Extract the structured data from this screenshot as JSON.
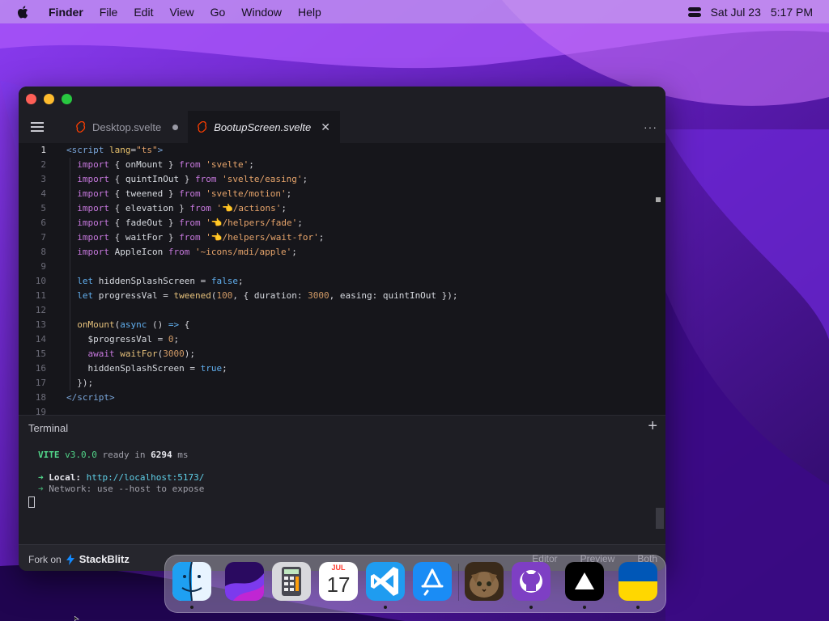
{
  "menubar": {
    "app_name": "Finder",
    "items": [
      "File",
      "Edit",
      "View",
      "Go",
      "Window",
      "Help"
    ],
    "date": "Sat Jul 23",
    "time": "5:17 PM"
  },
  "editor": {
    "tabs": [
      {
        "label": "Desktop.svelte",
        "active": false,
        "modified": true
      },
      {
        "label": "BootupScreen.svelte",
        "active": true,
        "close": "✕"
      }
    ],
    "more_menu": "···",
    "lines": [
      {
        "n": "1",
        "current": true
      },
      {
        "n": "2"
      },
      {
        "n": "3"
      },
      {
        "n": "4"
      },
      {
        "n": "5"
      },
      {
        "n": "6"
      },
      {
        "n": "7"
      },
      {
        "n": "8"
      },
      {
        "n": "9"
      },
      {
        "n": "10"
      },
      {
        "n": "11"
      },
      {
        "n": "12"
      },
      {
        "n": "13"
      },
      {
        "n": "14"
      },
      {
        "n": "15"
      },
      {
        "n": "16"
      },
      {
        "n": "17"
      },
      {
        "n": "18"
      },
      {
        "n": "19"
      }
    ],
    "code": {
      "l1": [
        "<",
        "script",
        " ",
        "lang",
        "=",
        "\"ts\"",
        ">"
      ],
      "l2": [
        "import",
        " { ",
        "onMount",
        " } ",
        "from",
        " ",
        "'svelte'",
        ";"
      ],
      "l3": [
        "import",
        " { ",
        "quintInOut",
        " } ",
        "from",
        " ",
        "'svelte/easing'",
        ";"
      ],
      "l4": [
        "import",
        " { ",
        "tweened",
        " } ",
        "from",
        " ",
        "'svelte/motion'",
        ";"
      ],
      "l5": [
        "import",
        " { ",
        "elevation",
        " } ",
        "from",
        " ",
        "'",
        "👈",
        "/actions'",
        ";"
      ],
      "l6": [
        "import",
        " { ",
        "fadeOut",
        " } ",
        "from",
        " ",
        "'",
        "👈",
        "/helpers/fade'",
        ";"
      ],
      "l7": [
        "import",
        " { ",
        "waitFor",
        " } ",
        "from",
        " ",
        "'",
        "👈",
        "/helpers/wait-for'",
        ";"
      ],
      "l8": [
        "import",
        " ",
        "AppleIcon",
        " ",
        "from",
        " ",
        "'~icons/mdi/apple'",
        ";"
      ],
      "l10": [
        "let",
        " ",
        "hiddenSplashScreen",
        " = ",
        "false",
        ";"
      ],
      "l11": [
        "let",
        " ",
        "progressVal",
        " = ",
        "tweened",
        "(",
        "100",
        ", { ",
        "duration",
        ": ",
        "3000",
        ", ",
        "easing",
        ": ",
        "quintInOut",
        " });"
      ],
      "l13": [
        "onMount",
        "(",
        "async",
        " () ",
        "=>",
        " {"
      ],
      "l14": [
        "$progressVal",
        " = ",
        "0",
        ";"
      ],
      "l15": [
        "await",
        " ",
        "waitFor",
        "(",
        "3000",
        ");"
      ],
      "l16": [
        "hiddenSplashScreen",
        " = ",
        "true",
        ";"
      ],
      "l17": [
        "});"
      ],
      "l18": [
        "</",
        "script",
        ">"
      ]
    }
  },
  "terminal": {
    "title": "Terminal",
    "add": "+",
    "vite": "VITE",
    "vite_version": "v3.0.0",
    "ready_text": "ready in",
    "ready_ms": "6294",
    "ms": "ms",
    "arrow": "➜",
    "local_label": "Local:",
    "local_url": "http://localhost:5173/",
    "network_label": "Network:",
    "network_hint": "use --host to expose"
  },
  "footer": {
    "fork_on": "Fork on",
    "brand": "StackBlitz",
    "modes": [
      "Editor",
      "Preview",
      "Both"
    ]
  },
  "dock": {
    "apps": [
      {
        "name": "Finder",
        "icon": "finder-icon",
        "running": true
      },
      {
        "name": "Wallpapers",
        "icon": "wallpaper-icon",
        "running": false
      },
      {
        "name": "Calculator",
        "icon": "calculator-icon",
        "running": false
      },
      {
        "name": "Calendar",
        "icon": "calendar-icon",
        "running": false,
        "month": "JUL",
        "day": "17"
      },
      {
        "name": "VS Code",
        "icon": "vscode-icon",
        "running": true
      },
      {
        "name": "App Store",
        "icon": "app-store-icon",
        "running": false
      },
      {
        "name": "Purrr",
        "icon": "cat-photo-icon",
        "running": false
      },
      {
        "name": "GitHub",
        "icon": "github-icon",
        "running": true
      },
      {
        "name": "Vercel",
        "icon": "vercel-icon",
        "running": true
      },
      {
        "name": "Ukraine",
        "icon": "ukraine-flag-icon",
        "running": true
      }
    ]
  },
  "colors": {
    "accent": "#52d68a",
    "editor_bg": "#16161b",
    "window_bg": "#1e1e24",
    "svelte": "#ff3e00"
  }
}
